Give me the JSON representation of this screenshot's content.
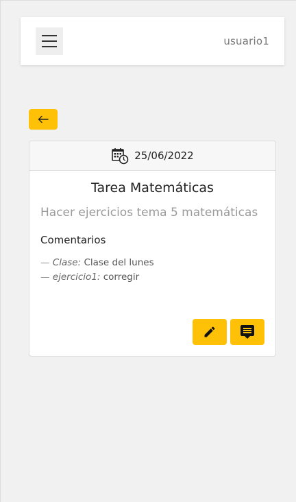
{
  "header": {
    "username": "usuario1"
  },
  "task": {
    "date": "25/06/2022",
    "title": "Tarea Matemáticas",
    "description": "Hacer ejercicios tema 5 matemáticas",
    "comments_title": "Comentarios",
    "comments": [
      {
        "key": "Clase:",
        "value": "Clase del lunes"
      },
      {
        "key": "ejercicio1:",
        "value": "corregir"
      }
    ]
  },
  "icons": {
    "menu": "hamburger-icon",
    "back": "arrow-left-icon",
    "date": "calendar-clock-icon",
    "edit": "pencil-icon",
    "comment": "comment-icon"
  },
  "colors": {
    "accent": "#ffc107",
    "background": "#f1f1f1"
  }
}
